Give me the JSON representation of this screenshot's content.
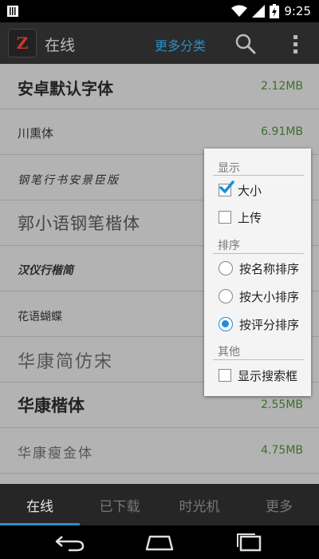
{
  "status_bar": {
    "time": "9:25"
  },
  "action_bar": {
    "title": "在线",
    "more_categories": "更多分类",
    "app_icon_letter": "Z",
    "accent": "#2a8fc4"
  },
  "fonts": [
    {
      "name": "安卓默认字体",
      "size": "2.12MB"
    },
    {
      "name": "川熏体",
      "size": "6.91MB"
    },
    {
      "name": "钢笔行书安景臣版",
      "size": ""
    },
    {
      "name": "郭小语钢笔楷体",
      "size": ""
    },
    {
      "name": "汉仪行楷简",
      "size": ""
    },
    {
      "name": "花语蝴蝶",
      "size": ""
    },
    {
      "name": "华康简仿宋",
      "size": ""
    },
    {
      "name": "华康楷体",
      "size": "2.55MB"
    },
    {
      "name": "华康瘦金体",
      "size": "4.75MB"
    }
  ],
  "popup": {
    "display_header": "显示",
    "size_option": {
      "label": "大小",
      "checked": true
    },
    "upload_option": {
      "label": "上传",
      "checked": false
    },
    "sort_header": "排序",
    "sort_name": {
      "label": "按名称排序",
      "selected": false
    },
    "sort_size": {
      "label": "按大小排序",
      "selected": false
    },
    "sort_rating": {
      "label": "按评分排序",
      "selected": true
    },
    "other_header": "其他",
    "show_search": {
      "label": "显示搜索框",
      "checked": false
    }
  },
  "tabs": [
    {
      "label": "在线",
      "active": true
    },
    {
      "label": "已下载",
      "active": false
    },
    {
      "label": "时光机",
      "active": false
    },
    {
      "label": "更多",
      "active": false
    }
  ]
}
